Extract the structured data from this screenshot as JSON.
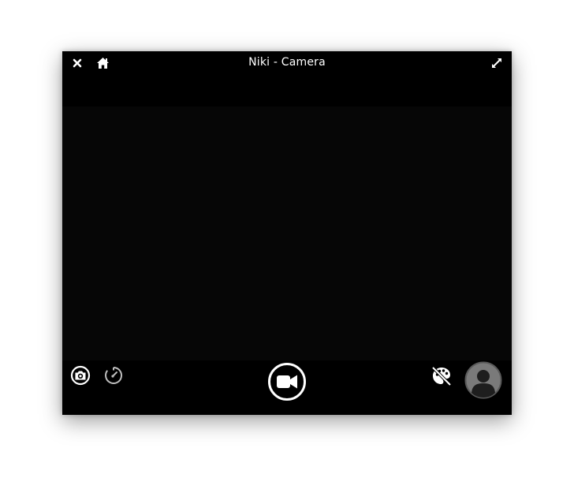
{
  "window": {
    "title": "Niki - Camera"
  },
  "titlebar": {
    "icons": [
      "close-icon",
      "home-icon",
      "fullscreen-icon"
    ]
  },
  "controls": {
    "left": [
      "camera-mode-icon",
      "timer-icon"
    ],
    "center": "video-record-icon",
    "right": [
      "filters-palette-icon",
      "gallery-avatar-icon"
    ]
  },
  "colors": {
    "window_bg": "#000000",
    "viewfinder_bg": "#060606",
    "icon_fg": "#ffffff",
    "icon_dim": "#bdbdbd",
    "avatar_bg": "#7a7a7a"
  }
}
